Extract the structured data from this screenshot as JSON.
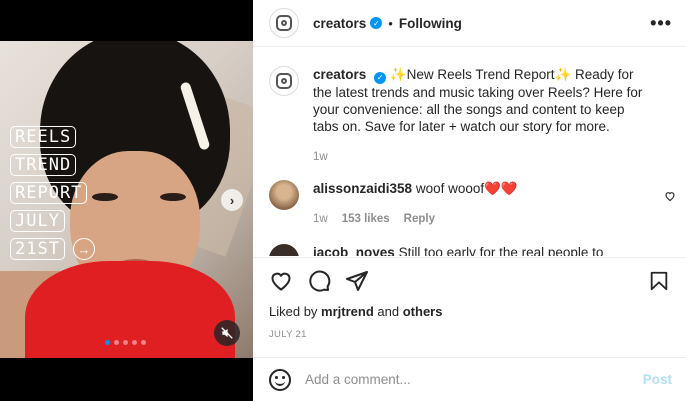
{
  "post": {
    "stickers": [
      "REELS",
      "TREND",
      "REPORT",
      "JULY",
      "21ST"
    ],
    "carousel_count": 5,
    "carousel_active": 0
  },
  "header": {
    "username": "creators",
    "separator": "•",
    "follow_status": "Following",
    "more": "•••"
  },
  "caption": {
    "username": "creators",
    "text": "✨New Reels Trend Report✨ Ready for the latest trends and music taking over Reels? Here for your convenience: all the songs and content to keep tabs on. Save for later + watch our story for more.",
    "time": "1w"
  },
  "comments": [
    {
      "username": "alissonzaidi358",
      "text": "woof wooof❤️❤️",
      "time": "1w",
      "likes": "153 likes",
      "reply": "Reply"
    },
    {
      "username": "jacob_noyes",
      "text": "Still too early for the real people to"
    }
  ],
  "likes_line": {
    "prefix": "Liked by",
    "user": "mrjtrend",
    "middle": "and",
    "others": "others"
  },
  "date": "JULY 21",
  "comment_box": {
    "placeholder": "Add a comment...",
    "post_label": "Post"
  },
  "colors": {
    "accent": "#0095f6",
    "post_disabled": "#b2dffc",
    "heart": "#ed4956"
  }
}
